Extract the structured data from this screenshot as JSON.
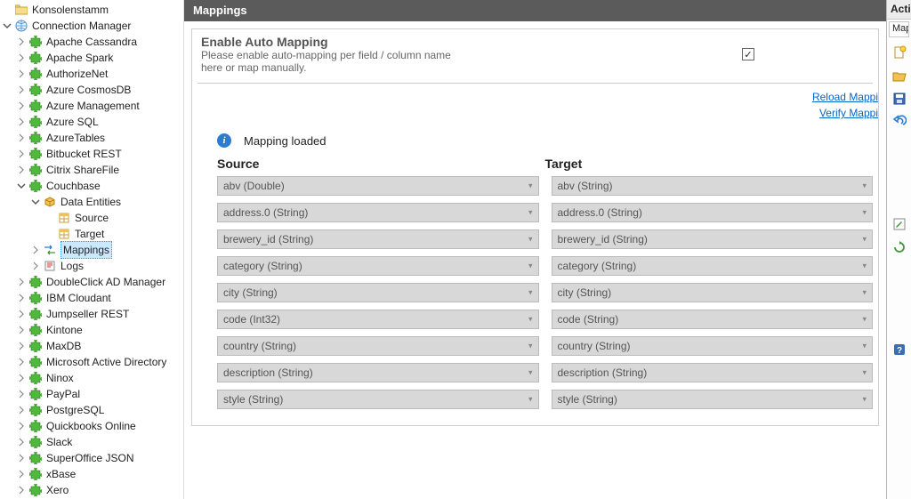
{
  "tree": {
    "root_label": "Konsolenstamm",
    "conn_mgr_label": "Connection Manager",
    "couchbase_label": "Couchbase",
    "data_entities_label": "Data Entities",
    "source_label": "Source",
    "target_label": "Target",
    "mappings_label": "Mappings",
    "logs_label": "Logs",
    "connectors": [
      "Apache Cassandra",
      "Apache Spark",
      "AuthorizeNet",
      "Azure CosmosDB",
      "Azure Management",
      "Azure SQL",
      "AzureTables",
      "Bitbucket REST",
      "Citrix ShareFile",
      "Couchbase",
      "DoubleClick  AD Manager",
      "IBM Cloudant",
      "Jumpseller REST",
      "Kintone",
      "MaxDB",
      "Microsoft Active Directory",
      "Ninox",
      "PayPal",
      "PostgreSQL",
      "Quickbooks Online",
      "Slack",
      "SuperOffice JSON",
      "xBase",
      "Xero"
    ]
  },
  "panel": {
    "title": "Mappings",
    "auto_title": "Enable Auto Mapping",
    "auto_desc1": "Please enable auto-mapping per field / column name",
    "auto_desc2": "here or map manually.",
    "auto_checked": true,
    "link_reload": "Reload Mappi",
    "link_verify": "Verify Mappi",
    "status_text": "Mapping loaded",
    "col_source": "Source",
    "col_target": "Target",
    "rows": [
      {
        "source": "abv (Double)",
        "target": "abv (String)"
      },
      {
        "source": "address.0 (String)",
        "target": "address.0 (String)"
      },
      {
        "source": "brewery_id (String)",
        "target": "brewery_id (String)"
      },
      {
        "source": "category (String)",
        "target": "category (String)"
      },
      {
        "source": "city (String)",
        "target": "city (String)"
      },
      {
        "source": "code (Int32)",
        "target": "code (String)"
      },
      {
        "source": "country (String)",
        "target": "country (String)"
      },
      {
        "source": "description (String)",
        "target": "description (String)"
      },
      {
        "source": "style (String)",
        "target": "style (String)"
      }
    ]
  },
  "actions": {
    "header": "Acti",
    "tab": "Map",
    "icons": [
      "new-icon",
      "open-icon",
      "save-icon",
      "undo-icon",
      "edit-icon",
      "refresh-icon",
      "help-icon"
    ]
  }
}
